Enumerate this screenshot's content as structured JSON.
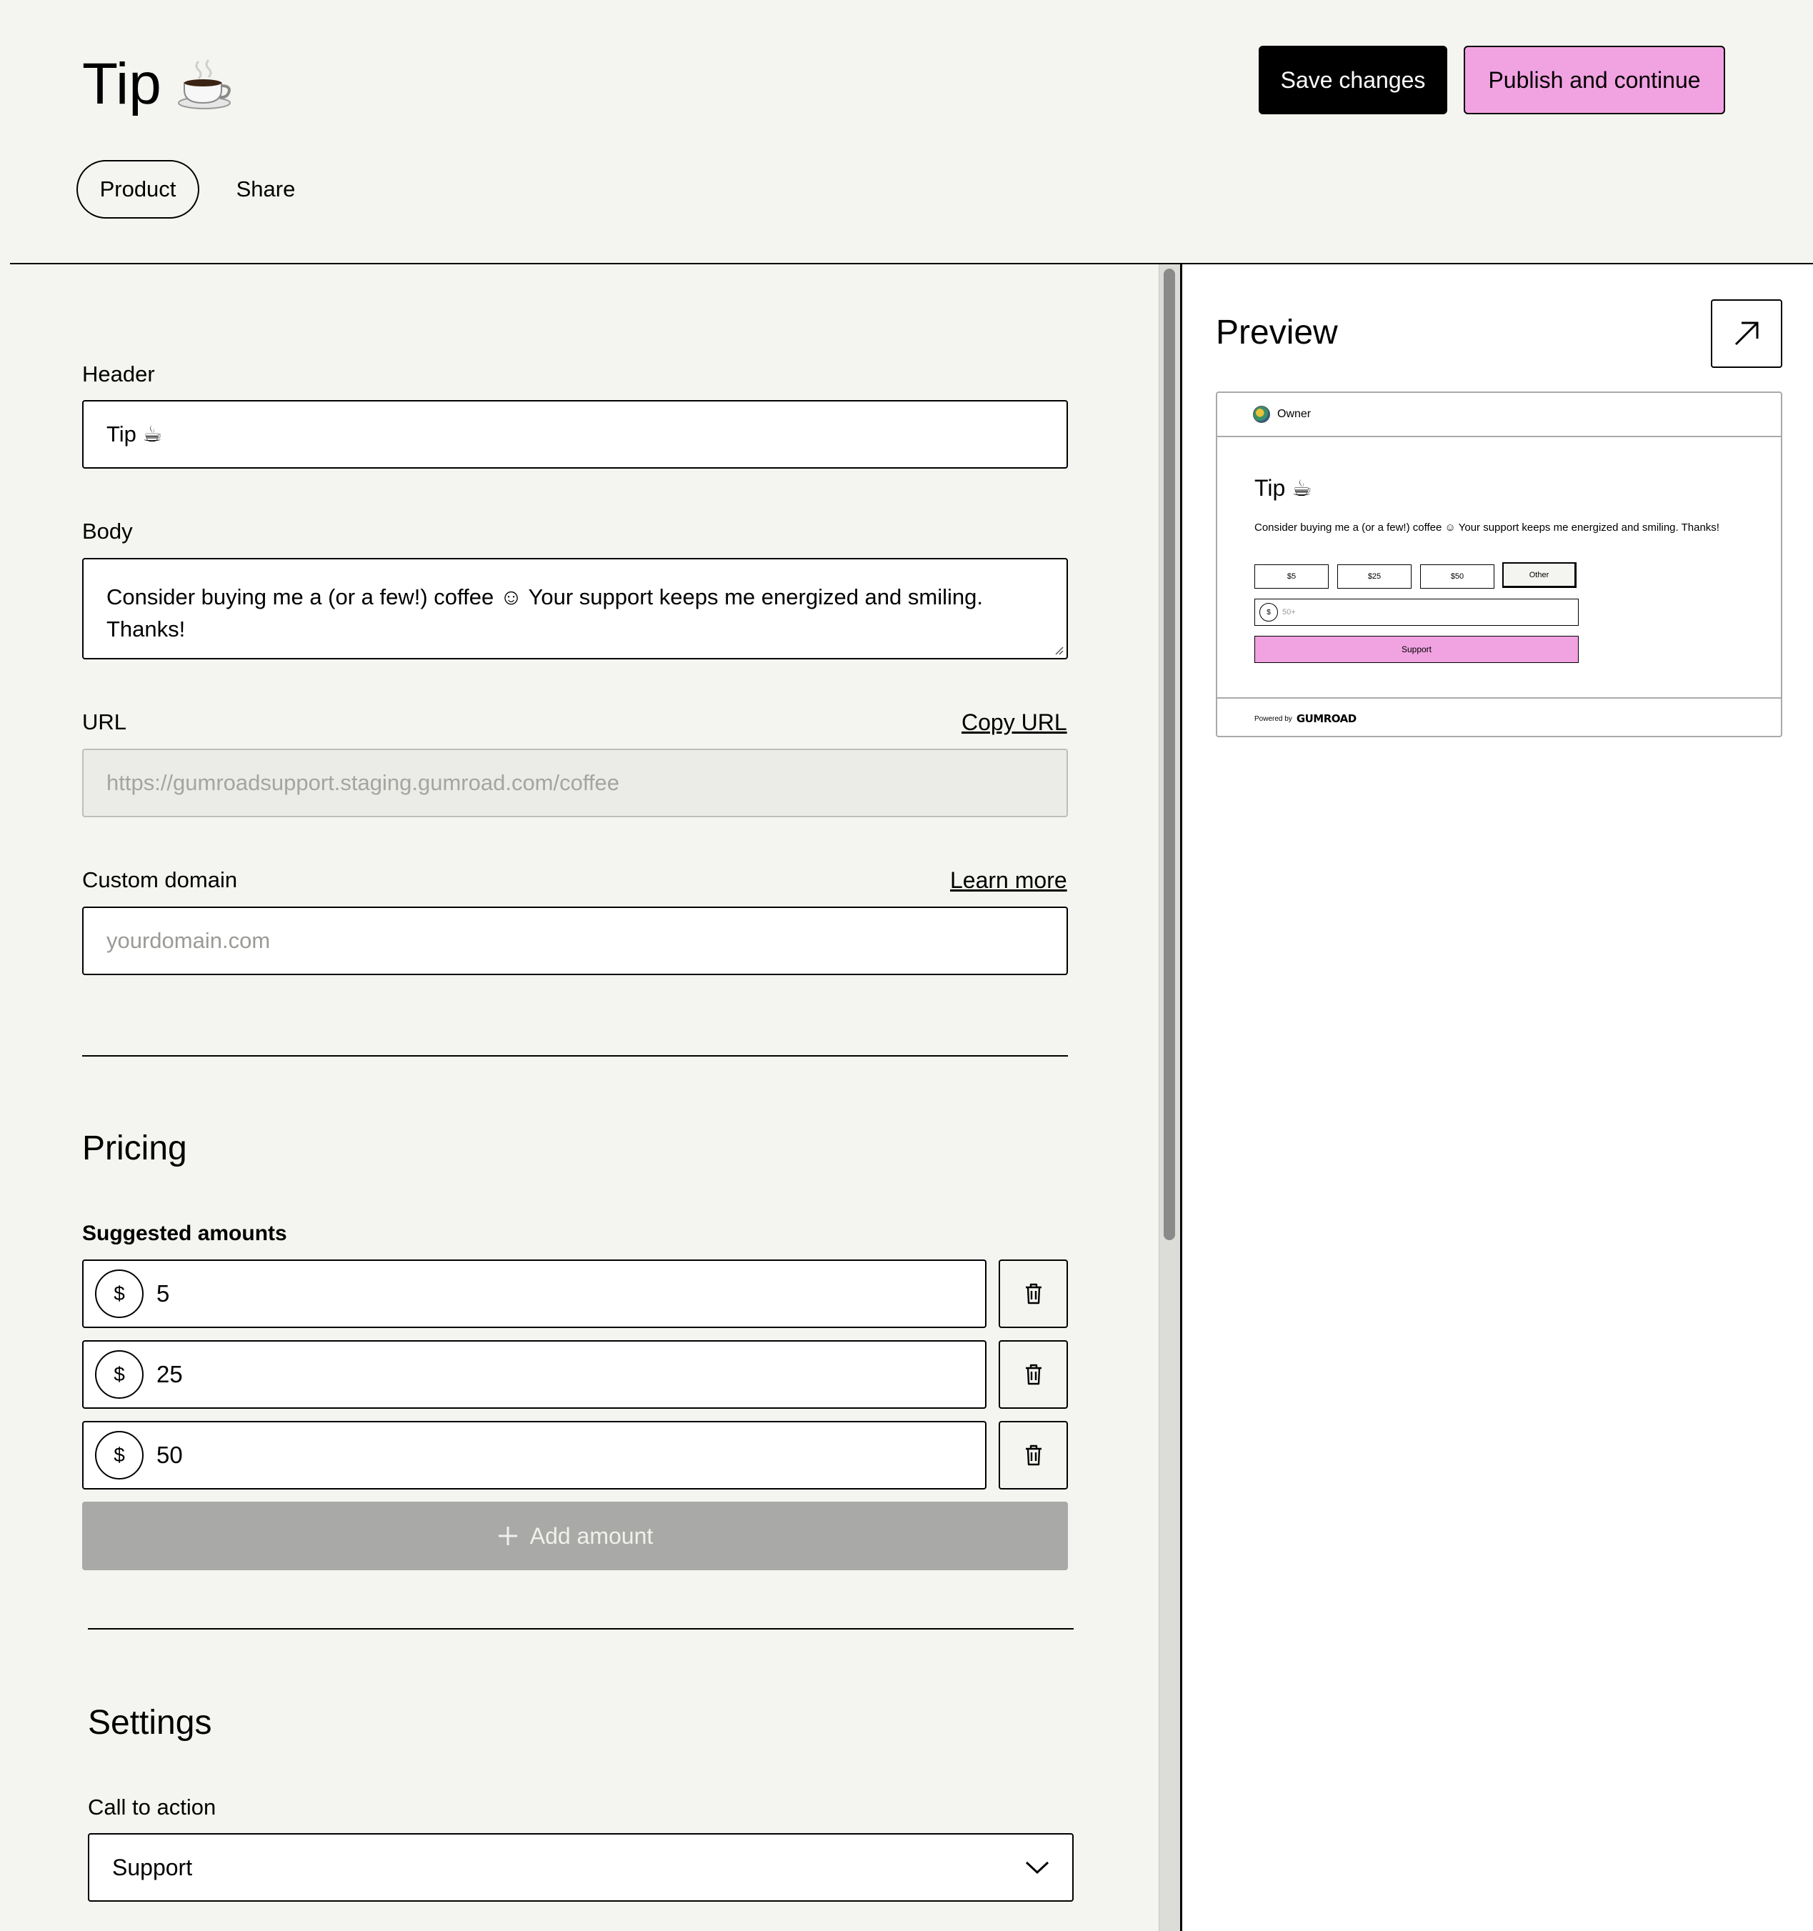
{
  "header": {
    "title": "Tip",
    "title_icon": "coffee-cup-icon",
    "save_label": "Save changes",
    "publish_label": "Publish and continue"
  },
  "tabs": [
    {
      "label": "Product",
      "selected": true
    },
    {
      "label": "Share",
      "selected": false
    }
  ],
  "form": {
    "header_label": "Header",
    "header_value": "Tip ☕",
    "body_label": "Body",
    "body_value": "Consider buying me a (or a few!) coffee ☺ Your support keeps me energized and smiling. Thanks!",
    "url_label": "URL",
    "copy_url_label": "Copy URL",
    "url_value": "https://gumroadsupport.staging.gumroad.com/coffee",
    "custom_domain_label": "Custom domain",
    "learn_more_label": "Learn more",
    "custom_domain_placeholder": "yourdomain.com"
  },
  "pricing": {
    "title": "Pricing",
    "suggested_label": "Suggested amounts",
    "currency_symbol": "$",
    "amounts": [
      "5",
      "25",
      "50"
    ],
    "add_amount_label": "Add amount"
  },
  "settings": {
    "title": "Settings",
    "cta_label": "Call to action",
    "cta_value": "Support"
  },
  "preview": {
    "title": "Preview",
    "owner_name": "Owner",
    "product_title": "Tip ☕",
    "description": "Consider buying me a (or a few!) coffee ☺ Your support keeps me energized and smiling. Thanks!",
    "amount_options": [
      "$5",
      "$25",
      "$50",
      "Other"
    ],
    "currency_symbol": "$",
    "input_placeholder": "50+",
    "button_label": "Support",
    "powered_by": "Powered by",
    "brand": "GUMROAD"
  },
  "colors": {
    "background": "#f4f4f0",
    "accent_pink": "#f1a2e1",
    "disabled_gray": "#a9a9a7"
  }
}
